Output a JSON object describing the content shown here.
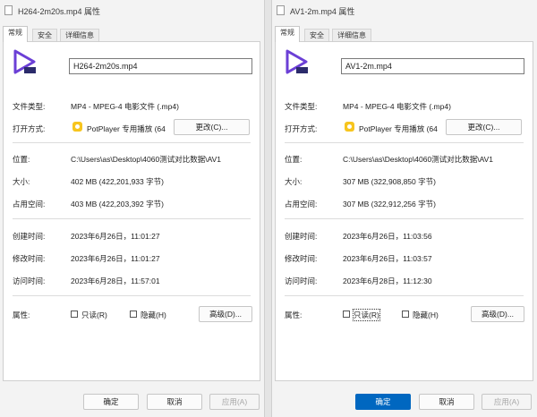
{
  "left": {
    "title": "H264-2m20s.mp4 属性",
    "tabs": [
      "常规",
      "安全",
      "详细信息"
    ],
    "filename": "H264-2m20s.mp4",
    "rows": {
      "type_label": "文件类型:",
      "type_value": "MP4 - MPEG-4 电影文件 (.mp4)",
      "open_label": "打开方式:",
      "open_value": "PotPlayer 专用播放 (64",
      "change_button": "更改(C)...",
      "location_label": "位置:",
      "location_value": "C:\\Users\\as\\Desktop\\4060测试对比数据\\AV1",
      "size_label": "大小:",
      "size_value": "402 MB (422,201,933 字节)",
      "disk_label": "占用空间:",
      "disk_value": "403 MB (422,203,392 字节)",
      "created_label": "创建时间:",
      "created_value": "2023年6月26日，11:01:27",
      "modified_label": "修改时间:",
      "modified_value": "2023年6月26日，11:01:27",
      "accessed_label": "访问时间:",
      "accessed_value": "2023年6月28日，11:57:01",
      "attr_label": "属性:",
      "readonly_label": "只读(R)",
      "hidden_label": "隐藏(H)",
      "advanced_button": "高级(D)..."
    },
    "buttons": {
      "ok": "确定",
      "cancel": "取消",
      "apply": "应用(A)"
    }
  },
  "right": {
    "title": "AV1-2m.mp4 属性",
    "tabs": [
      "常规",
      "安全",
      "详细信息"
    ],
    "filename": "AV1-2m.mp4",
    "rows": {
      "type_label": "文件类型:",
      "type_value": "MP4 - MPEG-4 电影文件 (.mp4)",
      "open_label": "打开方式:",
      "open_value": "PotPlayer 专用播放 (64",
      "change_button": "更改(C)...",
      "location_label": "位置:",
      "location_value": "C:\\Users\\as\\Desktop\\4060测试对比数据\\AV1",
      "size_label": "大小:",
      "size_value": "307 MB (322,908,850 字节)",
      "disk_label": "占用空间:",
      "disk_value": "307 MB (322,912,256 字节)",
      "created_label": "创建时间:",
      "created_value": "2023年6月26日，11:03:56",
      "modified_label": "修改时间:",
      "modified_value": "2023年6月26日，11:03:57",
      "accessed_label": "访问时间:",
      "accessed_value": "2023年6月28日，11:12:30",
      "attr_label": "属性:",
      "readonly_label": "只读(R)",
      "hidden_label": "隐藏(H)",
      "advanced_button": "高级(D)..."
    },
    "buttons": {
      "ok": "确定",
      "cancel": "取消",
      "apply": "应用(A)"
    }
  },
  "colors": {
    "accent": "#0067c0",
    "icon_purple": "#6b3fd6",
    "potplayer_yellow": "#f7c51e"
  }
}
